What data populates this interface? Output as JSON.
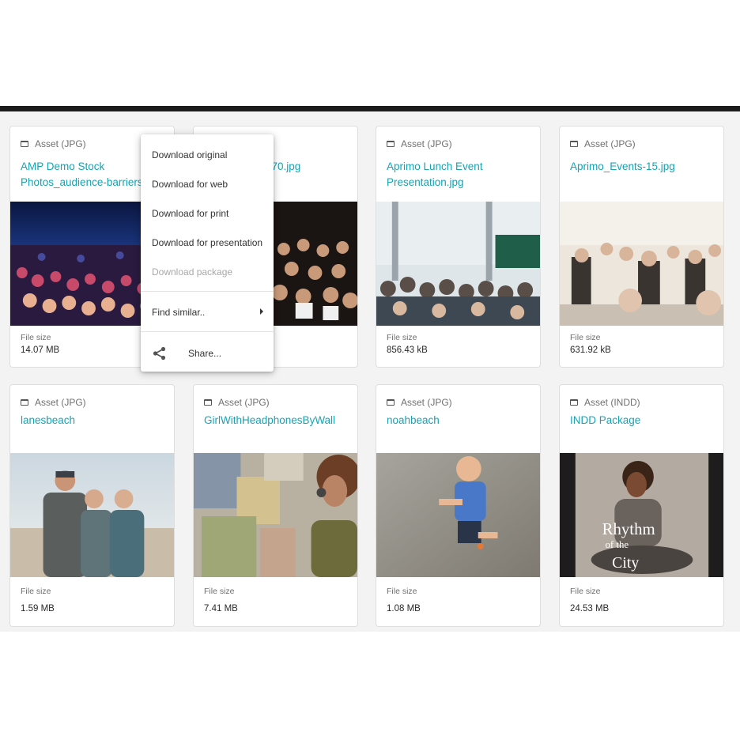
{
  "cards": [
    {
      "type": "Asset (JPG)",
      "title_line1": "AMP Demo Stock",
      "title_line2": "Photos_audience-barriers",
      "file_size_label": "File size",
      "file_size": "14.07 MB"
    },
    {
      "type": "",
      "title_line1": "-70.jpg",
      "title_line2": "",
      "file_size_label": "",
      "file_size": ""
    },
    {
      "type": "Asset (JPG)",
      "title_line1": "Aprimo Lunch Event",
      "title_line2": "Presentation.jpg",
      "file_size_label": "File size",
      "file_size": "856.43 kB"
    },
    {
      "type": "Asset (JPG)",
      "title_line1": "Aprimo_Events-15.jpg",
      "title_line2": "",
      "file_size_label": "File size",
      "file_size": "631.92 kB"
    },
    {
      "type": "Asset (JPG)",
      "title_line1": "lanesbeach",
      "title_line2": "",
      "file_size_label": "File size",
      "file_size": "1.59 MB"
    },
    {
      "type": "Asset (JPG)",
      "title_line1": "GirlWithHeadphonesByWall",
      "title_line2": "",
      "file_size_label": "File size",
      "file_size": "7.41 MB"
    },
    {
      "type": "Asset (JPG)",
      "title_line1": "noahbeach",
      "title_line2": "",
      "file_size_label": "File size",
      "file_size": "1.08 MB"
    },
    {
      "type": "Asset (INDD)",
      "title_line1": "INDD Package",
      "title_line2": "",
      "file_size_label": "File size",
      "file_size": "24.53 MB"
    }
  ],
  "menu": {
    "download_original": "Download original",
    "download_web": "Download for web",
    "download_print": "Download for print",
    "download_presentation": "Download for presentation",
    "download_package": "Download package",
    "find_similar": "Find similar..",
    "share": "Share..."
  },
  "thumbnail_text": {
    "line1": "Rhythm",
    "line2": "of the",
    "line3": "City"
  },
  "colors": {
    "accent": "#16a3b2",
    "top_bar": "#1c1c1c",
    "grid_background": "#f3f3f3"
  },
  "icons": {
    "asset_type": "asset-document-icon",
    "submenu": "chevron-right-icon",
    "share": "share-icon"
  }
}
